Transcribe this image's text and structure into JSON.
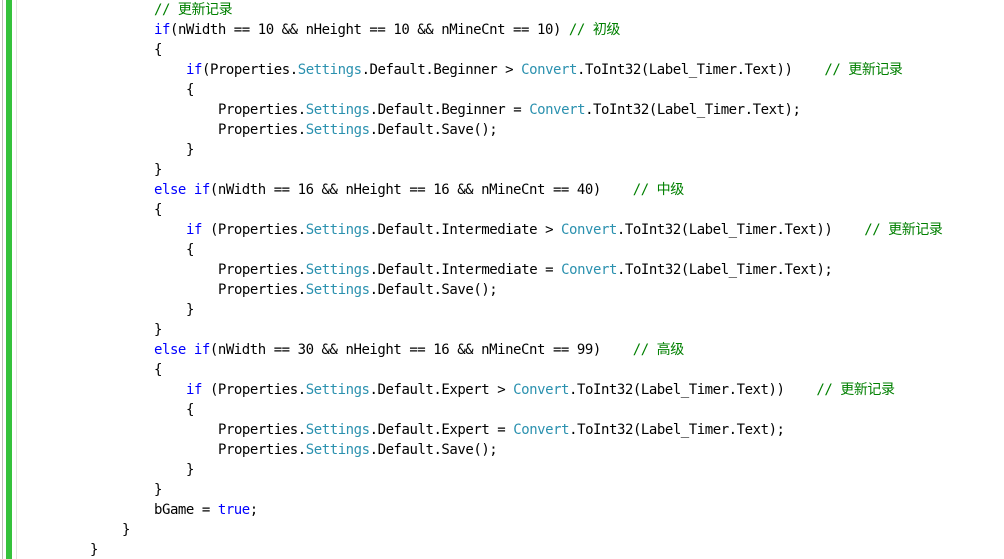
{
  "colors": {
    "keyword": "#0000ff",
    "type": "#2b91af",
    "comment": "#008000",
    "plain": "#000000",
    "change_bar": "#35c23c"
  },
  "lines": [
    {
      "indent": 4,
      "tokens": [
        {
          "t": "cm",
          "v": "// 更新记录"
        }
      ]
    },
    {
      "indent": 4,
      "tokens": [
        {
          "t": "kw",
          "v": "if"
        },
        {
          "t": "pl",
          "v": "(nWidth == 10 && nHeight == 10 && nMineCnt == 10) "
        },
        {
          "t": "cm",
          "v": "// 初级"
        }
      ]
    },
    {
      "indent": 4,
      "tokens": [
        {
          "t": "pl",
          "v": "{"
        }
      ]
    },
    {
      "indent": 5,
      "tokens": [
        {
          "t": "kw",
          "v": "if"
        },
        {
          "t": "pl",
          "v": "(Properties."
        },
        {
          "t": "type",
          "v": "Settings"
        },
        {
          "t": "pl",
          "v": ".Default.Beginner > "
        },
        {
          "t": "type",
          "v": "Convert"
        },
        {
          "t": "pl",
          "v": ".ToInt32(Label_Timer.Text))    "
        },
        {
          "t": "cm",
          "v": "// 更新记录"
        }
      ]
    },
    {
      "indent": 5,
      "tokens": [
        {
          "t": "pl",
          "v": "{"
        }
      ]
    },
    {
      "indent": 6,
      "tokens": [
        {
          "t": "pl",
          "v": "Properties."
        },
        {
          "t": "type",
          "v": "Settings"
        },
        {
          "t": "pl",
          "v": ".Default.Beginner = "
        },
        {
          "t": "type",
          "v": "Convert"
        },
        {
          "t": "pl",
          "v": ".ToInt32(Label_Timer.Text);"
        }
      ]
    },
    {
      "indent": 6,
      "tokens": [
        {
          "t": "pl",
          "v": "Properties."
        },
        {
          "t": "type",
          "v": "Settings"
        },
        {
          "t": "pl",
          "v": ".Default.Save();"
        }
      ]
    },
    {
      "indent": 5,
      "tokens": [
        {
          "t": "pl",
          "v": "}"
        }
      ]
    },
    {
      "indent": 4,
      "tokens": [
        {
          "t": "pl",
          "v": "}"
        }
      ]
    },
    {
      "indent": 4,
      "tokens": [
        {
          "t": "kw",
          "v": "else if"
        },
        {
          "t": "pl",
          "v": "(nWidth == 16 && nHeight == 16 && nMineCnt == 40)    "
        },
        {
          "t": "cm",
          "v": "// 中级"
        }
      ]
    },
    {
      "indent": 4,
      "tokens": [
        {
          "t": "pl",
          "v": "{"
        }
      ]
    },
    {
      "indent": 5,
      "tokens": [
        {
          "t": "kw",
          "v": "if"
        },
        {
          "t": "pl",
          "v": " (Properties."
        },
        {
          "t": "type",
          "v": "Settings"
        },
        {
          "t": "pl",
          "v": ".Default.Intermediate > "
        },
        {
          "t": "type",
          "v": "Convert"
        },
        {
          "t": "pl",
          "v": ".ToInt32(Label_Timer.Text))    "
        },
        {
          "t": "cm",
          "v": "// 更新记录"
        }
      ]
    },
    {
      "indent": 5,
      "tokens": [
        {
          "t": "pl",
          "v": "{"
        }
      ]
    },
    {
      "indent": 6,
      "tokens": [
        {
          "t": "pl",
          "v": "Properties."
        },
        {
          "t": "type",
          "v": "Settings"
        },
        {
          "t": "pl",
          "v": ".Default.Intermediate = "
        },
        {
          "t": "type",
          "v": "Convert"
        },
        {
          "t": "pl",
          "v": ".ToInt32(Label_Timer.Text);"
        }
      ]
    },
    {
      "indent": 6,
      "tokens": [
        {
          "t": "pl",
          "v": "Properties."
        },
        {
          "t": "type",
          "v": "Settings"
        },
        {
          "t": "pl",
          "v": ".Default.Save();"
        }
      ]
    },
    {
      "indent": 5,
      "tokens": [
        {
          "t": "pl",
          "v": "}"
        }
      ]
    },
    {
      "indent": 4,
      "tokens": [
        {
          "t": "pl",
          "v": "}"
        }
      ]
    },
    {
      "indent": 4,
      "tokens": [
        {
          "t": "kw",
          "v": "else if"
        },
        {
          "t": "pl",
          "v": "(nWidth == 30 && nHeight == 16 && nMineCnt == 99)    "
        },
        {
          "t": "cm",
          "v": "// 高级"
        }
      ]
    },
    {
      "indent": 4,
      "tokens": [
        {
          "t": "pl",
          "v": "{"
        }
      ]
    },
    {
      "indent": 5,
      "tokens": [
        {
          "t": "kw",
          "v": "if"
        },
        {
          "t": "pl",
          "v": " (Properties."
        },
        {
          "t": "type",
          "v": "Settings"
        },
        {
          "t": "pl",
          "v": ".Default.Expert > "
        },
        {
          "t": "type",
          "v": "Convert"
        },
        {
          "t": "pl",
          "v": ".ToInt32(Label_Timer.Text))    "
        },
        {
          "t": "cm",
          "v": "// 更新记录"
        }
      ]
    },
    {
      "indent": 5,
      "tokens": [
        {
          "t": "pl",
          "v": "{"
        }
      ]
    },
    {
      "indent": 6,
      "tokens": [
        {
          "t": "pl",
          "v": "Properties."
        },
        {
          "t": "type",
          "v": "Settings"
        },
        {
          "t": "pl",
          "v": ".Default.Expert = "
        },
        {
          "t": "type",
          "v": "Convert"
        },
        {
          "t": "pl",
          "v": ".ToInt32(Label_Timer.Text);"
        }
      ]
    },
    {
      "indent": 6,
      "tokens": [
        {
          "t": "pl",
          "v": "Properties."
        },
        {
          "t": "type",
          "v": "Settings"
        },
        {
          "t": "pl",
          "v": ".Default.Save();"
        }
      ]
    },
    {
      "indent": 5,
      "tokens": [
        {
          "t": "pl",
          "v": "}"
        }
      ]
    },
    {
      "indent": 4,
      "tokens": [
        {
          "t": "pl",
          "v": "}"
        }
      ]
    },
    {
      "indent": 4,
      "tokens": [
        {
          "t": "pl",
          "v": "bGame = "
        },
        {
          "t": "kw",
          "v": "true"
        },
        {
          "t": "pl",
          "v": ";"
        }
      ]
    },
    {
      "indent": 3,
      "tokens": [
        {
          "t": "pl",
          "v": "}"
        }
      ]
    },
    {
      "indent": 2,
      "tokens": [
        {
          "t": "pl",
          "v": "}"
        }
      ]
    }
  ]
}
